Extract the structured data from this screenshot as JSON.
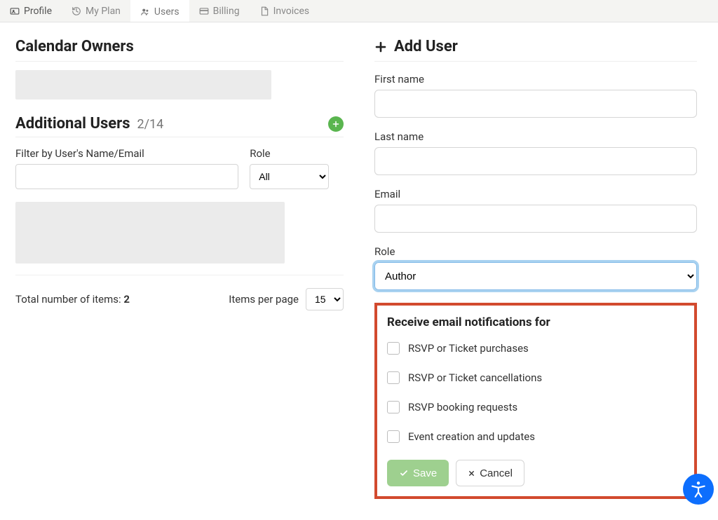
{
  "tabs": [
    {
      "label": "Profile"
    },
    {
      "label": "My Plan"
    },
    {
      "label": "Users"
    },
    {
      "label": "Billing"
    },
    {
      "label": "Invoices"
    }
  ],
  "left": {
    "owners_title": "Calendar Owners",
    "additional_title": "Additional Users",
    "additional_count": "2/14",
    "filter_name_label": "Filter by User's Name/Email",
    "filter_role_label": "Role",
    "filter_role_value": "All",
    "total_label": "Total number of items:",
    "total_value": "2",
    "perpage_label": "Items per page",
    "perpage_value": "15"
  },
  "right": {
    "title": "Add User",
    "first_name_label": "First name",
    "last_name_label": "Last name",
    "email_label": "Email",
    "role_label": "Role",
    "role_value": "Author",
    "notif_title": "Receive email notifications for",
    "cb1": "RSVP or Ticket purchases",
    "cb2": "RSVP or Ticket cancellations",
    "cb3": "RSVP booking requests",
    "cb4": "Event creation and updates",
    "save": "Save",
    "cancel": "Cancel"
  }
}
